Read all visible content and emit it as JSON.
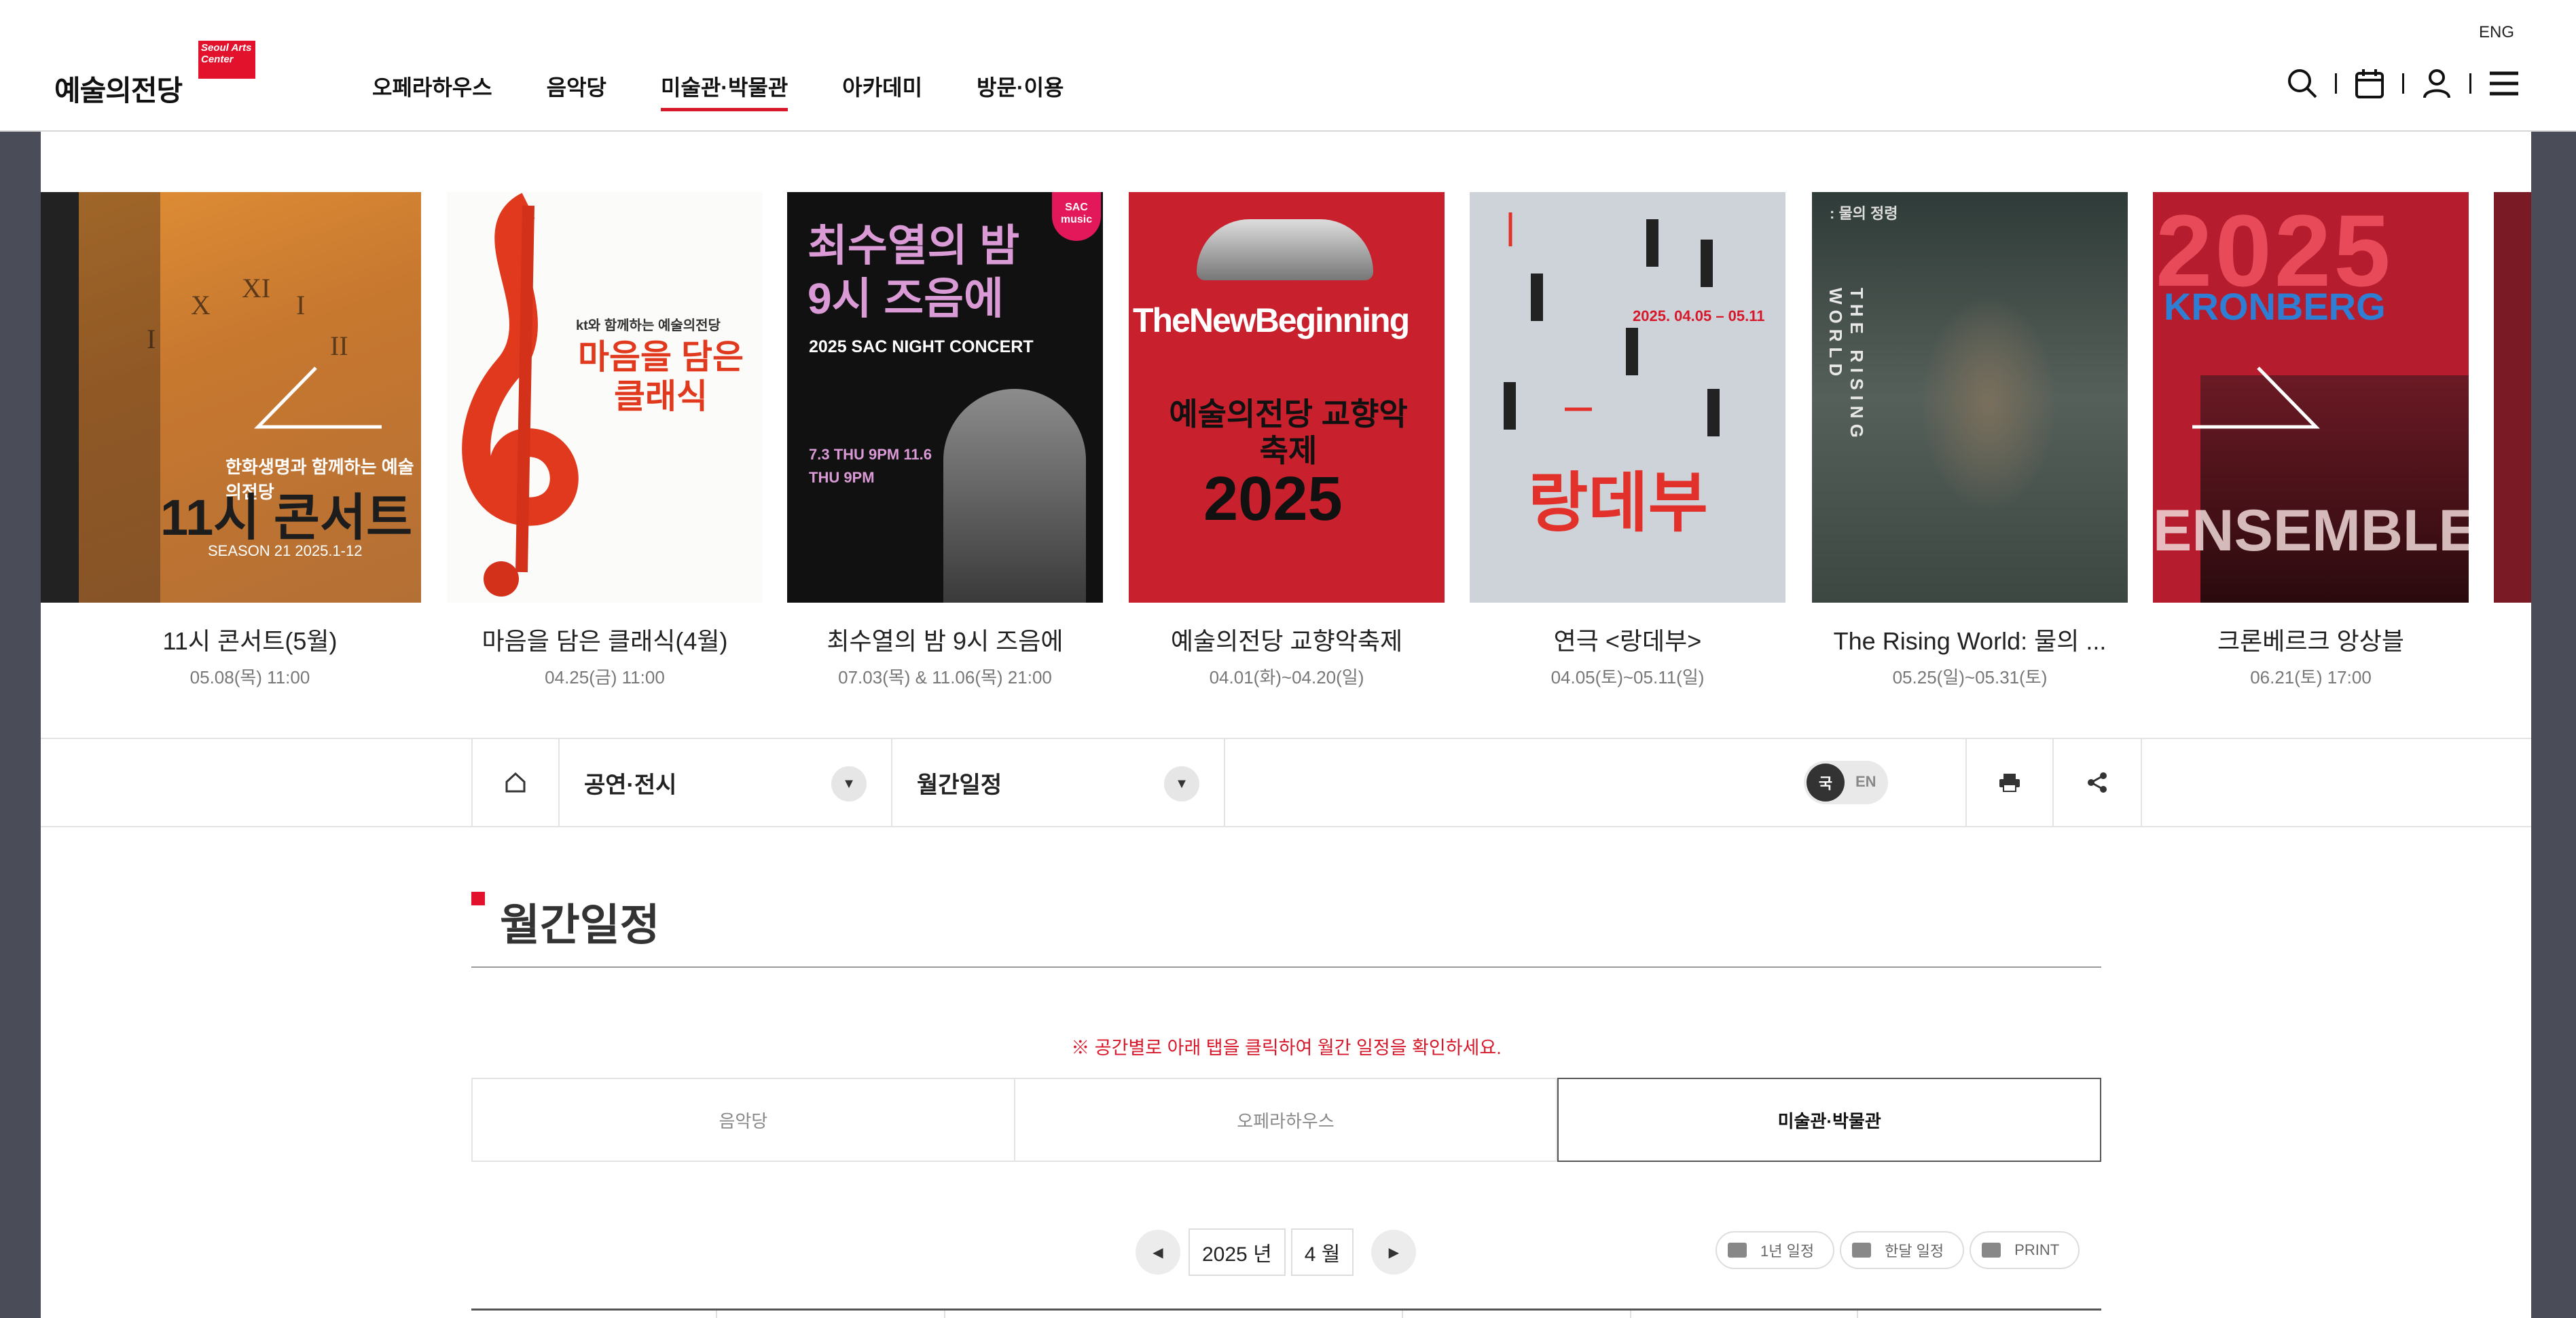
{
  "header": {
    "logo_badge": "Seoul Arts Center",
    "logo_text": "예술의전당",
    "lang_link": "ENG",
    "nav": [
      "오페라하우스",
      "음악당",
      "미술관·박물관",
      "아카데미",
      "방문·이용"
    ],
    "active_nav": "미술관·박물관"
  },
  "carousel": {
    "cards": [
      {
        "title": "11시 콘서트(5월)",
        "date": "05.08(목) 11:00",
        "poster": {
          "headline": "11시 콘서트",
          "sub": "한화생명과 함께하는 예술의전당",
          "note": "SEASON 21 2025.1-12"
        }
      },
      {
        "title": "마음을 담은 클래식(4월)",
        "date": "04.25(금) 11:00",
        "poster": {
          "headline": "마음을 담은 클래식",
          "sub": "kt와 함께하는 예술의전당"
        }
      },
      {
        "title": "최수열의 밤 9시 즈음에",
        "date": "07.03(목) & 11.06(목) 21:00",
        "poster": {
          "headline": "최수열의 밤 9시 즈음에",
          "sub": "2025 SAC NIGHT CONCERT",
          "note": "7.3 THU 9PM  11.6 THU 9PM",
          "badge": "SAC music"
        }
      },
      {
        "title": "예술의전당 교향악축제",
        "date": "04.01(화)~04.20(일)",
        "poster": {
          "headline": "TheNewBeginning",
          "sub": "예술의전당 교향악축제",
          "note": "2025"
        }
      },
      {
        "title": "연극 <랑데부>",
        "date": "04.05(토)~05.11(일)",
        "poster": {
          "headline": "랑데부",
          "sub": "2025. 04.05 – 05.11"
        }
      },
      {
        "title": "The Rising World: 물의 ...",
        "date": "05.25(일)~05.31(토)",
        "poster": {
          "headline": "THE RISING WORLD",
          "sub": ": 물의 정령"
        }
      },
      {
        "title": "크론베르크 앙상블",
        "date": "06.21(토) 17:00",
        "poster": {
          "headline": "2025",
          "sub": "KRONBERG",
          "note": "ENSEMBLE"
        }
      }
    ]
  },
  "subnav": {
    "section": "공연·전시",
    "page": "월간일정",
    "lang_on": "국",
    "lang_off": "EN"
  },
  "main": {
    "title": "월간일정",
    "notice": "※ 공간별로 아래 탭을 클릭하여 월간 일정을 확인하세요.",
    "tabs": [
      "음악당",
      "오페라하우스",
      "미술관·박물관"
    ],
    "active_tab": "미술관·박물관",
    "year": "2025 년",
    "month": "4 월",
    "print_buttons": [
      "1년 일정",
      "한달 일정",
      "PRINT"
    ]
  },
  "colors": {
    "accent": "#e2122c",
    "gutter": "#4a4c57"
  }
}
